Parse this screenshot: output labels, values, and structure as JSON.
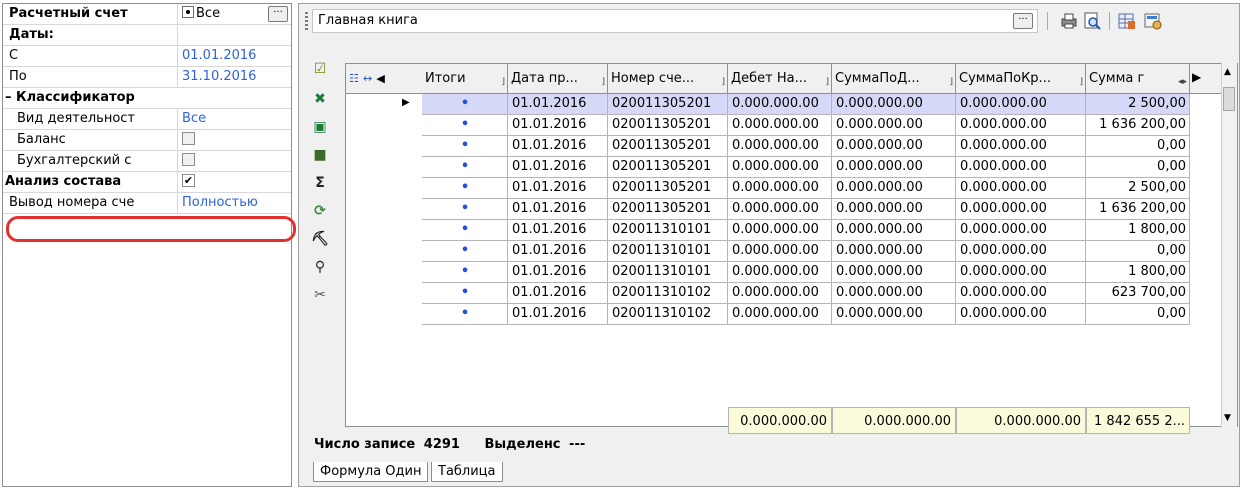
{
  "left_panel": {
    "rows": [
      {
        "label": "Расчетный счет",
        "value": "Все"
      },
      {
        "label": "Даты:"
      },
      {
        "label": "С",
        "value": "01.01.2016"
      },
      {
        "label": "По",
        "value": "31.10.2016"
      },
      {
        "label": "– Классификатор"
      },
      {
        "label": "Вид деятельност",
        "value": "Все"
      },
      {
        "label": "Баланс"
      },
      {
        "label": "Бухгалтерский с"
      },
      {
        "label": "Анализ состава"
      },
      {
        "label": "Вывод номера сче",
        "value": "Полностью"
      }
    ],
    "ellipsis": "···",
    "checkbox_checked": "✔"
  },
  "header": {
    "title": "Главная книга",
    "ellipsis": "···"
  },
  "grid": {
    "columns": [
      "Итоги",
      "Дата пр...",
      "Номер сче...",
      "Дебет На...",
      "СуммаПоД...",
      "СуммаПоКр...",
      "Сумма г"
    ],
    "rows": [
      {
        "date": "01.01.2016",
        "account": "020011305201",
        "debit": "0.000.000.00",
        "sum_d": "0.000.000.00",
        "sum_k": "0.000.000.00",
        "sum": "2 500,00"
      },
      {
        "date": "01.01.2016",
        "account": "020011305201",
        "debit": "0.000.000.00",
        "sum_d": "0.000.000.00",
        "sum_k": "0.000.000.00",
        "sum": "1 636 200,00"
      },
      {
        "date": "01.01.2016",
        "account": "020011305201",
        "debit": "0.000.000.00",
        "sum_d": "0.000.000.00",
        "sum_k": "0.000.000.00",
        "sum": "0,00"
      },
      {
        "date": "01.01.2016",
        "account": "020011305201",
        "debit": "0.000.000.00",
        "sum_d": "0.000.000.00",
        "sum_k": "0.000.000.00",
        "sum": "0,00"
      },
      {
        "date": "01.01.2016",
        "account": "020011305201",
        "debit": "0.000.000.00",
        "sum_d": "0.000.000.00",
        "sum_k": "0.000.000.00",
        "sum": "2 500,00"
      },
      {
        "date": "01.01.2016",
        "account": "020011305201",
        "debit": "0.000.000.00",
        "sum_d": "0.000.000.00",
        "sum_k": "0.000.000.00",
        "sum": "1 636 200,00"
      },
      {
        "date": "01.01.2016",
        "account": "020011310101",
        "debit": "0.000.000.00",
        "sum_d": "0.000.000.00",
        "sum_k": "0.000.000.00",
        "sum": "1 800,00"
      },
      {
        "date": "01.01.2016",
        "account": "020011310101",
        "debit": "0.000.000.00",
        "sum_d": "0.000.000.00",
        "sum_k": "0.000.000.00",
        "sum": "0,00"
      },
      {
        "date": "01.01.2016",
        "account": "020011310101",
        "debit": "0.000.000.00",
        "sum_d": "0.000.000.00",
        "sum_k": "0.000.000.00",
        "sum": "1 800,00"
      },
      {
        "date": "01.01.2016",
        "account": "020011310102",
        "debit": "0.000.000.00",
        "sum_d": "0.000.000.00",
        "sum_k": "0.000.000.00",
        "sum": "623 700,00"
      },
      {
        "date": "01.01.2016",
        "account": "020011310102",
        "debit": "0.000.000.00",
        "sum_d": "0.000.000.00",
        "sum_k": "0.000.000.00",
        "sum": "0,00"
      }
    ],
    "totals": {
      "debit": "0.000.000.00",
      "sum_d": "0.000.000.00",
      "sum_k": "0.000.000.00",
      "sum": "1 842 655 2..."
    },
    "row_dot": "•"
  },
  "status": {
    "records_label": "Число записе",
    "records_value": "4291",
    "selected_label": "Выделенс",
    "selected_value": "---"
  },
  "tabs": [
    "Формула Один",
    "Таблица"
  ]
}
